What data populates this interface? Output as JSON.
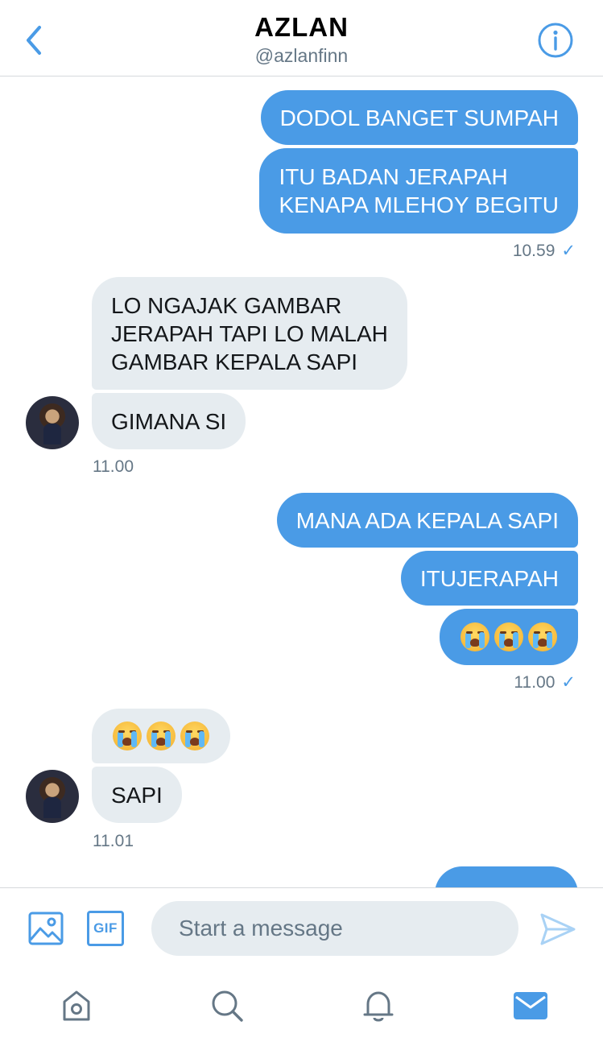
{
  "header": {
    "title": "AZLAN",
    "handle": "@azlanfinn",
    "back_icon": "chevron-left-icon",
    "info_icon": "info-icon"
  },
  "colors": {
    "accent": "#4a9be6",
    "incoming_bubble": "#e6ecf0",
    "meta_text": "#657786"
  },
  "messages": [
    {
      "dir": "out",
      "lines": [
        "DODOL BANGET SUMPAH"
      ]
    },
    {
      "dir": "out",
      "lines": [
        "ITU BADAN JERAPAH",
        "KENAPA MLEHOY BEGITU"
      ]
    },
    {
      "time": "10.59",
      "read": "✓"
    },
    {
      "dir": "in",
      "lines": [
        "LO NGAJAK GAMBAR",
        "JERAPAH TAPI LO MALAH",
        "GAMBAR KEPALA SAPI"
      ]
    },
    {
      "dir": "in",
      "lines": [
        "GIMANA SI"
      ]
    },
    {
      "time": "11.00"
    },
    {
      "dir": "out",
      "lines": [
        "MANA ADA KEPALA SAPI"
      ]
    },
    {
      "dir": "out",
      "lines": [
        "ITUJERAPAH"
      ]
    },
    {
      "dir": "out",
      "emoji": [
        "loudly-crying-face",
        "loudly-crying-face",
        "loudly-crying-face"
      ]
    },
    {
      "time": "11.00",
      "read": "✓"
    },
    {
      "dir": "in",
      "emoji": [
        "loudly-crying-face",
        "loudly-crying-face",
        "loudly-crying-face"
      ]
    },
    {
      "dir": "in",
      "lines": [
        "SAPI"
      ]
    },
    {
      "time": "11.01"
    }
  ],
  "composer": {
    "placeholder": "Start a message",
    "gif_label": "GIF",
    "image_icon": "image-icon",
    "send_icon": "send-icon"
  },
  "tabbar": {
    "items": [
      "home-icon",
      "search-icon",
      "bell-icon",
      "mail-icon"
    ],
    "active": "mail-icon"
  }
}
